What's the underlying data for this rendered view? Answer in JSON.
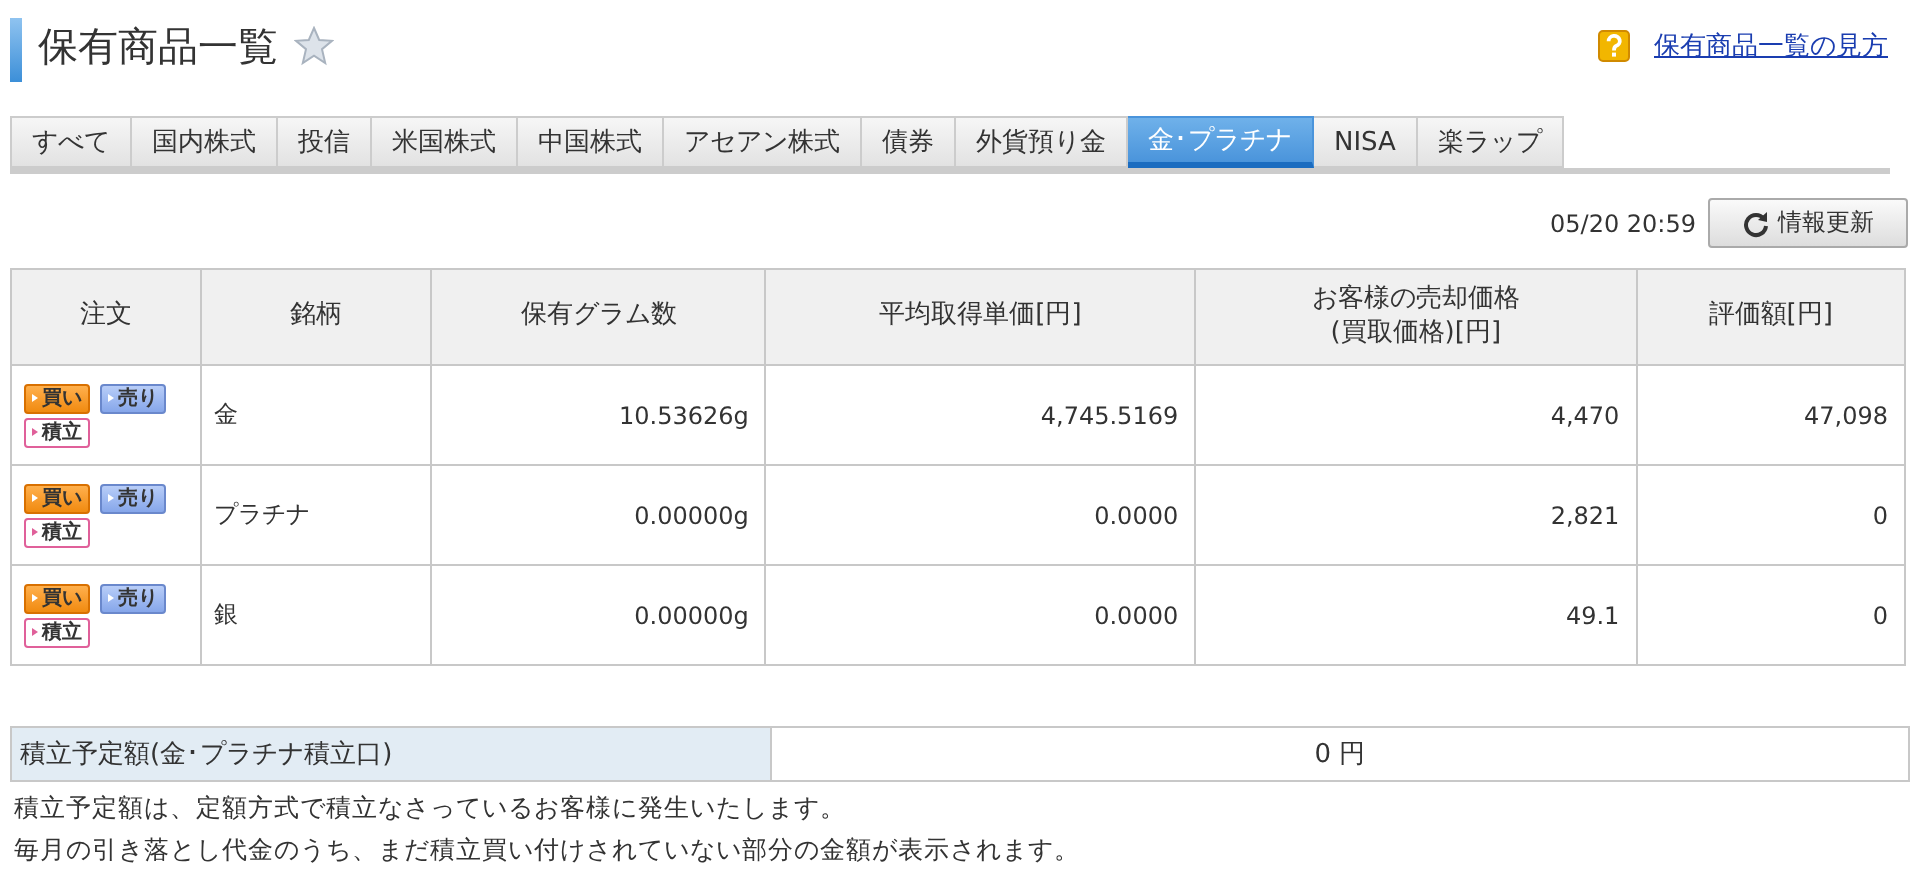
{
  "page_title": "保有商品一覧",
  "help_link": "保有商品一覧の見方",
  "tabs": [
    {
      "label": "すべて",
      "selected": false
    },
    {
      "label": "国内株式",
      "selected": false
    },
    {
      "label": "投信",
      "selected": false
    },
    {
      "label": "米国株式",
      "selected": false
    },
    {
      "label": "中国株式",
      "selected": false
    },
    {
      "label": "アセアン株式",
      "selected": false
    },
    {
      "label": "債券",
      "selected": false
    },
    {
      "label": "外貨預り金",
      "selected": false
    },
    {
      "label": "金･プラチナ",
      "selected": true
    },
    {
      "label": "NISA",
      "selected": false
    },
    {
      "label": "楽ラップ",
      "selected": false
    }
  ],
  "updated_at": "05/20 20:59",
  "refresh_button": "情報更新",
  "table": {
    "columns": [
      "注文",
      "銘柄",
      "保有グラム数",
      "平均取得単価[円]",
      "お客様の売却価格\n(買取価格)[円]",
      "評価額[円]"
    ],
    "rows": [
      {
        "order_buttons": [
          {
            "kind": "buy",
            "label": "買い"
          },
          {
            "kind": "sell",
            "label": "売り"
          },
          {
            "kind": "accumulate",
            "label": "積立"
          }
        ],
        "name": "金",
        "grams": "10.53626g",
        "avg_price": "4,745.5169",
        "sell_price": "4,470",
        "value": "47,098"
      },
      {
        "order_buttons": [
          {
            "kind": "buy",
            "label": "買い"
          },
          {
            "kind": "sell",
            "label": "売り"
          },
          {
            "kind": "accumulate",
            "label": "積立"
          }
        ],
        "name": "プラチナ",
        "grams": "0.00000g",
        "avg_price": "0.0000",
        "sell_price": "2,821",
        "value": "0"
      },
      {
        "order_buttons": [
          {
            "kind": "buy",
            "label": "買い"
          },
          {
            "kind": "sell",
            "label": "売り"
          },
          {
            "kind": "accumulate",
            "label": "積立"
          }
        ],
        "name": "銀",
        "grams": "0.00000g",
        "avg_price": "0.0000",
        "sell_price": "49.1",
        "value": "0"
      }
    ]
  },
  "summary": {
    "label": "積立予定額(金･プラチナ積立口)",
    "value": "0 円"
  },
  "notes": [
    "積立予定額は、定額方式で積立なさっているお客様に発生いたします。",
    "毎月の引き落とし代金のうち、まだ積立買い付けされていない部分の金額が表示されます。"
  ]
}
